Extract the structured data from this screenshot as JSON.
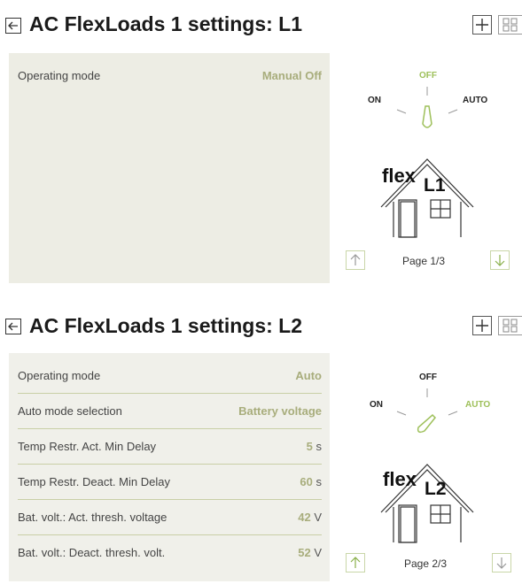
{
  "section1": {
    "title": "AC FlexLoads 1 settings: L1",
    "rows": [
      {
        "label": "Operating mode",
        "value": "Manual Off",
        "unit": ""
      }
    ],
    "switch": {
      "off": "OFF",
      "on": "ON",
      "auto": "AUTO",
      "active": "off"
    },
    "flex_text": "flex",
    "flex_sub": "L1",
    "page": "Page 1/3"
  },
  "section2": {
    "title": "AC FlexLoads 1 settings: L2",
    "rows": [
      {
        "label": "Operating mode",
        "value": "Auto",
        "unit": ""
      },
      {
        "label": "Auto mode selection",
        "value": "Battery voltage",
        "unit": ""
      },
      {
        "label": "Temp Restr. Act. Min Delay",
        "value": "5",
        "unit": "s"
      },
      {
        "label": "Temp Restr. Deact. Min Delay",
        "value": "60",
        "unit": "s"
      },
      {
        "label": "Bat. volt.: Act. thresh. voltage",
        "value": "42",
        "unit": "V"
      },
      {
        "label": "Bat. volt.: Deact. thresh. volt.",
        "value": "52",
        "unit": "V"
      }
    ],
    "switch": {
      "off": "OFF",
      "on": "ON",
      "auto": "AUTO",
      "active": "auto"
    },
    "flex_text": "flex",
    "flex_sub": "L2",
    "page": "Page 2/3"
  },
  "colors": {
    "accent": "#9ec05a",
    "value": "#a8ad7c",
    "panel": "#f0f0ea"
  },
  "icons": [
    "back-arrow-icon",
    "plus-icon",
    "grid-icon",
    "arrow-up-icon",
    "arrow-down-icon",
    "house-icon",
    "switch-knob-icon"
  ]
}
